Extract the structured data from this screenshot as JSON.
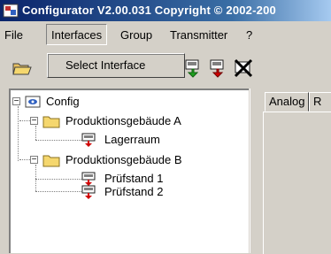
{
  "window": {
    "title": "Configurator  V2.00.031 Copyright © 2002-200"
  },
  "menu": {
    "items": [
      "File",
      "Interfaces",
      "Group",
      "Transmitter",
      "?"
    ],
    "active_index": 1
  },
  "dropdown": {
    "items": [
      "Select Interface"
    ]
  },
  "toolbar": {
    "buttons": [
      "open-folder-icon",
      "transmitter-green-icon",
      "transmitter-red-icon",
      "cancel-icon"
    ]
  },
  "tree": {
    "root": "Config",
    "groups": [
      {
        "label": "Produktionsgebäude A",
        "children": [
          "Lagerraum"
        ]
      },
      {
        "label": "Produktionsgebäude B",
        "children": [
          "Prüfstand 1",
          "Prüfstand 2"
        ]
      }
    ]
  },
  "tabs": [
    "Analog",
    "R"
  ],
  "colors": {
    "titlebar_start": "#0a246a",
    "titlebar_end": "#a6caf0",
    "folder_yellow": "#f5d76e",
    "transmitter_red": "#d00000"
  }
}
